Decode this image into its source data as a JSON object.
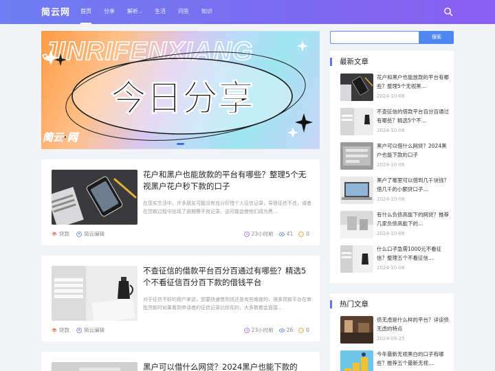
{
  "site": {
    "logo": "简云网",
    "nav": [
      {
        "label": "首页",
        "active": true
      },
      {
        "label": "分享"
      },
      {
        "label": "解析",
        "dropdown": true
      },
      {
        "label": "生活"
      },
      {
        "label": "问答"
      },
      {
        "label": "知识"
      }
    ],
    "search_icon": "search-icon"
  },
  "banner": {
    "outline_text": "JINRIFENXIANG",
    "headline": "今日分享",
    "brand": "简云·网"
  },
  "articles": [
    {
      "title": "花户和黑户也能放款的平台有哪些？整理5个无视黑户花户秒下款的口子",
      "excerpt": "在现实生活中，许多朋友可能没有充分珍惜个人征信记录，导致征信不佳，或者在贷款过程中出现了逾期等不良记录。这可能会使他们成为黑…",
      "category": "贷款",
      "author": "简云编辑",
      "time": "23小时前",
      "views": "41",
      "comments": "0"
    },
    {
      "title": "不查征信的借款平台百分百通过有哪些？精选5个不看征信百分百下款的借钱平台",
      "excerpt": "对于征信不好的用户来说，想要快速借到钱还是有些难度的，很多贷款平台在审批贷款时如果看到申请者的征信记录比较花的，大多数都会直接…",
      "category": "贷款",
      "author": "简云编辑",
      "time": "23小时前",
      "views": "26",
      "comments": "0"
    },
    {
      "title": "黑户可以借什么网贷？2024黑户也能下款的"
    }
  ],
  "sidebar": {
    "search_button": "搜索",
    "latest": {
      "title": "最新文章",
      "items": [
        {
          "title": "花户和黑户也能放款的平台有哪些？整理5个无视黑…",
          "date": "2024-10-06"
        },
        {
          "title": "不查征信的借款平台百分百通过有哪些？精选5个不…",
          "date": "2024-10-06"
        },
        {
          "title": "黑户可以借什么网贷？2024黑户也能下款的口子",
          "date": "2024-10-06"
        },
        {
          "title": "黑户了哪里可以借到几千块钱？借几千的小额贷口子…",
          "date": "2024-10-06"
        },
        {
          "title": "有什么负债高能下的网贷？推荐几家负债高能下的…",
          "date": "2024-10-06"
        },
        {
          "title": "什么口子急需1000元不看征信？整理五个不看征信…",
          "date": "2024-10-06"
        }
      ]
    },
    "hot": {
      "title": "热门文章",
      "items": [
        {
          "title": "债无虑是什么样的平台？详谈债无虑的特点",
          "date": "2024-09-25"
        },
        {
          "title": "今年最新无视黑白的口子有哪些？推荐五个最新无视…",
          "date": ""
        }
      ]
    }
  },
  "colors": {
    "header_start": "#6f7ef2",
    "header_end": "#8a5ff0",
    "accent": "#4f87f0",
    "widget_bar": "#6b73e8"
  }
}
